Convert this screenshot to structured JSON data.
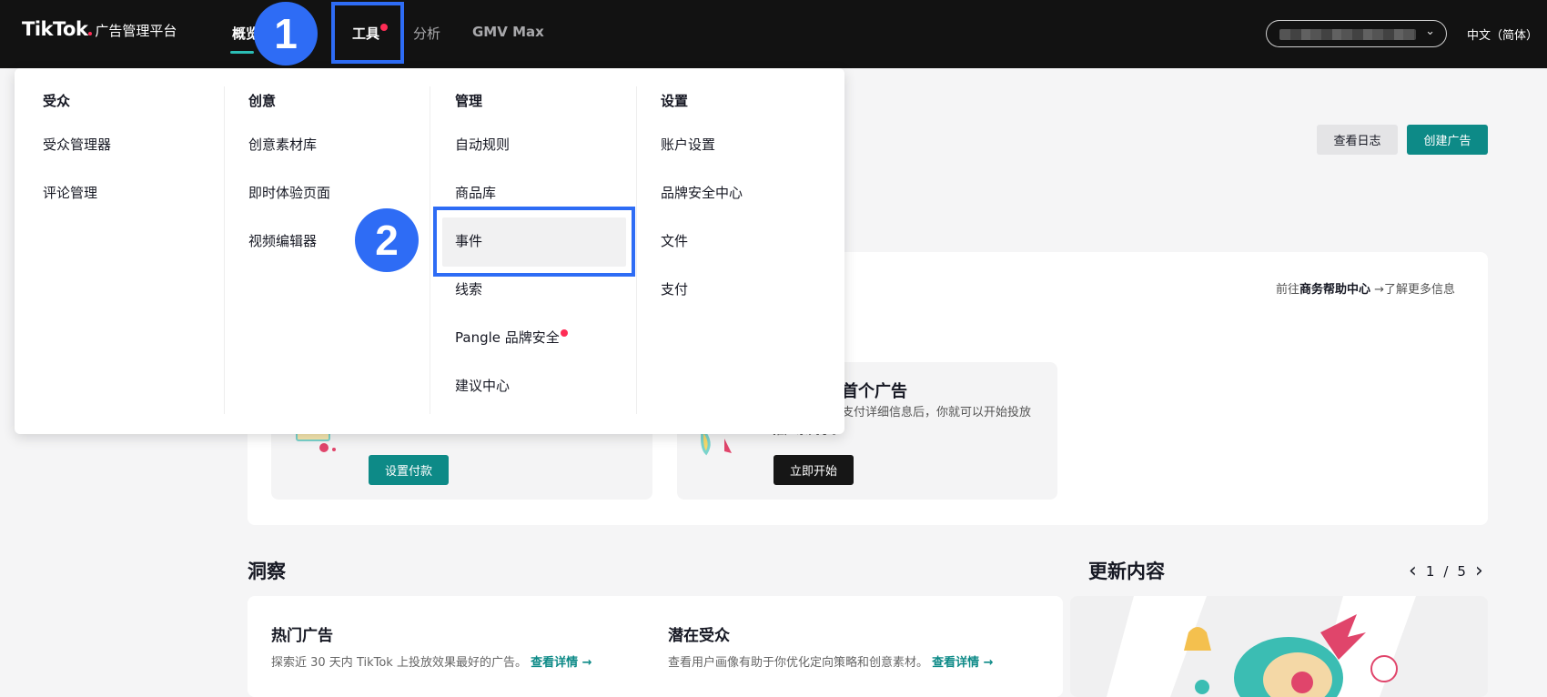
{
  "topnav": {
    "logo_brand": "TikTok",
    "logo_sub": "广告管理平台",
    "items": [
      {
        "label": "概览"
      },
      {
        "label": "工具"
      },
      {
        "label": "分析"
      },
      {
        "label": "GMV Max"
      }
    ],
    "language": "中文（简体）",
    "account_chevron": "⌄"
  },
  "callouts": {
    "one": "1",
    "two": "2"
  },
  "dropdown": {
    "columns": [
      {
        "heading": "受众",
        "items": [
          "受众管理器",
          "评论管理"
        ]
      },
      {
        "heading": "创意",
        "items": [
          "创意素材库",
          "即时体验页面",
          "视频编辑器"
        ]
      },
      {
        "heading": "管理",
        "items": [
          "自动规则",
          "商品库",
          "事件",
          "线索",
          "Pangle 品牌安全",
          "建议中心"
        ]
      },
      {
        "heading": "设置",
        "items": [
          "账户设置",
          "品牌安全中心",
          "文件",
          "支付"
        ]
      }
    ]
  },
  "main": {
    "view_log": "查看日志",
    "create_ad": "创建广告",
    "help_prefix": "前往",
    "help_center": "商务帮助中心",
    "help_suffix": " →了解更多信息",
    "card_title": "首个广告",
    "card_desc": "支付详细信息后，你就可以开始投放",
    "card_desc2": "推广系列了。",
    "setup_payment": "设置付款",
    "start_now": "立即开始",
    "insights_title": "洞察",
    "updates_title": "更新内容",
    "pager": {
      "prev": "‹",
      "current": "1",
      "sep": "/",
      "total": "5",
      "next": "›"
    },
    "hot_ads_title": "热门广告",
    "hot_ads_desc": "探索近 30 天内 TikTok 上投放效果最好的广告。",
    "hot_ads_link": "查看详情 →",
    "audience_title": "潜在受众",
    "audience_desc": "查看用户画像有助于你优化定向策略和创意素材。",
    "audience_link": "查看详情 →"
  },
  "colors": {
    "accent": "#2e6cf5",
    "teal": "#0d8a87",
    "alert": "#fe2c55"
  }
}
